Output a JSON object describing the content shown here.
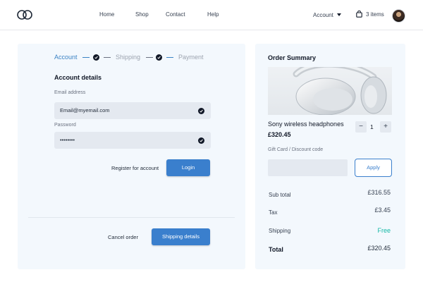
{
  "nav": {
    "items": [
      {
        "label": "Home"
      },
      {
        "label": "Shop"
      },
      {
        "label": "Contact"
      },
      {
        "label": "Help"
      }
    ],
    "account_label": "Account",
    "cart_label": "3 items"
  },
  "steps": [
    {
      "label": "Account",
      "state": "active"
    },
    {
      "label": "Shipping",
      "state": "inactive"
    },
    {
      "label": "Payment",
      "state": "inactive"
    }
  ],
  "account": {
    "title": "Account details",
    "email_label": "Email address",
    "email_value": "Email@myemail.com",
    "password_label": "Password",
    "password_value": "••••••••",
    "register_label": "Register for account",
    "login_label": "Login",
    "cancel_label": "Cancel order",
    "shipping_btn_label": "Shipping details"
  },
  "summary": {
    "title": "Order Summary",
    "product_name": "Sony wireless headphones",
    "product_price": "£320.45",
    "quantity": "1",
    "minus": "−",
    "plus": "+",
    "gift_label": "Gift Card / Discount code",
    "apply_label": "Apply",
    "rows": [
      {
        "label": "Sub total",
        "value": "£316.55"
      },
      {
        "label": "Tax",
        "value": "£3.45"
      },
      {
        "label": "Shipping",
        "value": "Free"
      },
      {
        "label": "Total",
        "value": "£320.45"
      }
    ]
  },
  "colors": {
    "accent": "#3a7fcd",
    "panel": "#f3f8fd",
    "free": "#14b8a6"
  }
}
